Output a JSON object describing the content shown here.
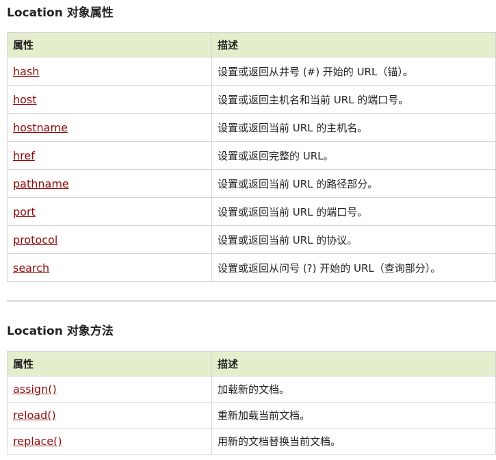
{
  "properties_section": {
    "title": "Location 对象属性",
    "headers": {
      "name": "属性",
      "description": "描述"
    },
    "rows": [
      {
        "name": "hash",
        "description": "设置或返回从井号 (#) 开始的 URL（锚）。"
      },
      {
        "name": "host",
        "description": "设置或返回主机名和当前 URL 的端口号。"
      },
      {
        "name": "hostname",
        "description": "设置或返回当前 URL 的主机名。"
      },
      {
        "name": "href",
        "description": "设置或返回完整的 URL。"
      },
      {
        "name": "pathname",
        "description": "设置或返回当前 URL 的路径部分。"
      },
      {
        "name": "port",
        "description": "设置或返回当前 URL 的端口号。"
      },
      {
        "name": "protocol",
        "description": "设置或返回当前 URL 的协议。"
      },
      {
        "name": "search",
        "description": "设置或返回从问号 (?) 开始的 URL（查询部分）。"
      }
    ]
  },
  "methods_section": {
    "title": "Location 对象方法",
    "headers": {
      "name": "属性",
      "description": "描述"
    },
    "rows": [
      {
        "name": "assign()",
        "description": "加载新的文档。"
      },
      {
        "name": "reload()",
        "description": "重新加载当前文档。"
      },
      {
        "name": "replace()",
        "description": "用新的文档替换当前文档。"
      }
    ]
  },
  "colors": {
    "header_bg": "#e5eecc",
    "link": "#900b09",
    "border": "#d4d4d4"
  }
}
